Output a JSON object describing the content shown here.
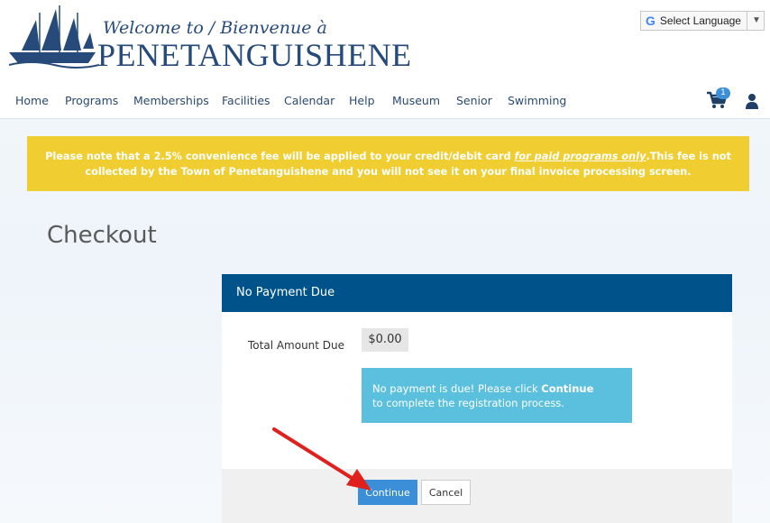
{
  "header": {
    "logo_script": "Welcome to / Bienvenue à",
    "logo_main": "PENETANGUISHENE",
    "language_selector": "Select Language",
    "language_arrow": "▼",
    "google_g": "G"
  },
  "nav": {
    "items": [
      "Home",
      "Programs",
      "Memberships",
      "Facilities",
      "Calendar",
      "Help",
      "Museum",
      "Senior",
      "Swimming"
    ],
    "cart_count": "1"
  },
  "notice": {
    "part1": "Please note that a 2.5% convenience fee will be applied to your credit/debit card ",
    "emphasis": "for paid programs only",
    "part2": ".This fee is not collected by the Town of Penetanguishene and you will not see it on your final invoice processing screen."
  },
  "page": {
    "title": "Checkout"
  },
  "panel": {
    "header": "No Payment Due",
    "amount_label": "Total Amount Due",
    "amount_value": "$0.00",
    "info_part1": "No payment is due! Please click ",
    "info_bold": "Continue",
    "info_part2": "to complete the registration process."
  },
  "buttons": {
    "continue": "Continue",
    "cancel": "Cancel"
  },
  "colors": {
    "brand_blue": "#264a7a",
    "panel_header": "#00538a",
    "notice_yellow": "#f0ce31",
    "info_cyan": "#5bc0de",
    "primary_button": "#3a8fd8",
    "annotation_arrow": "#e0201c"
  }
}
